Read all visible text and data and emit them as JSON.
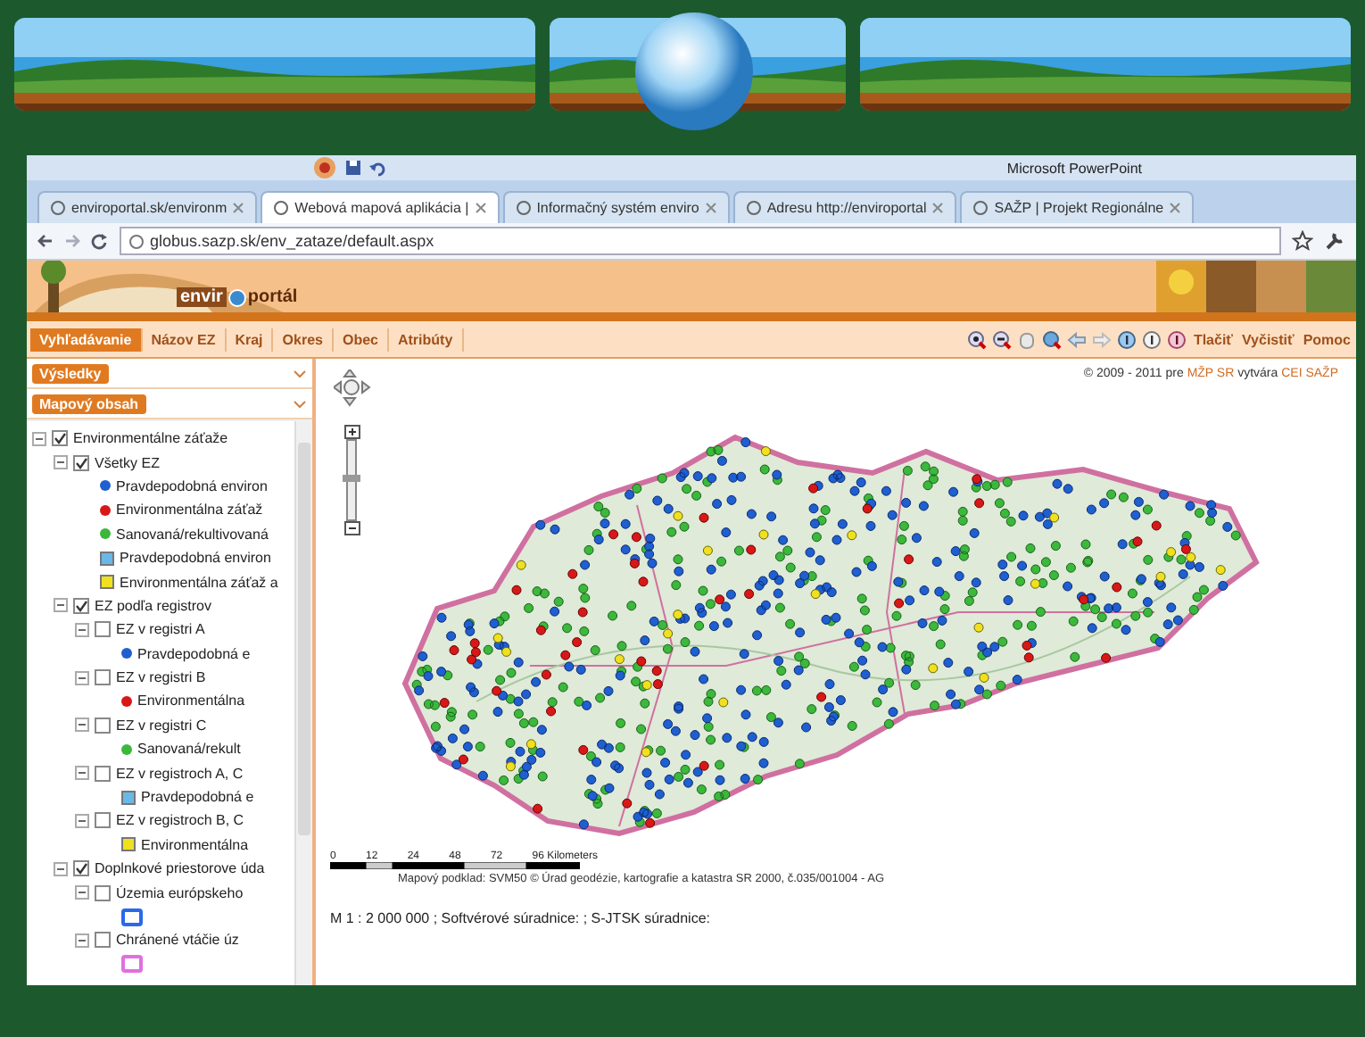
{
  "powerpoint": {
    "title": "Microsoft PowerPoint"
  },
  "browser": {
    "tabs": [
      {
        "label": "enviroportal.sk/environm",
        "selected": false
      },
      {
        "label": "Webová mapová aplikácia |",
        "selected": true
      },
      {
        "label": "Informačný systém enviro",
        "selected": false
      },
      {
        "label": "Adresu http://enviroportal",
        "selected": false
      },
      {
        "label": "SAŽP | Projekt Regionálne",
        "selected": false
      }
    ],
    "address": "globus.sazp.sk/env_zataze/default.aspx"
  },
  "portal": {
    "logo_left": "envir",
    "logo_right": "portál",
    "nav": [
      {
        "label": "Vyhľadávanie",
        "selected": true
      },
      {
        "label": "Názov EZ",
        "selected": false
      },
      {
        "label": "Kraj",
        "selected": false
      },
      {
        "label": "Okres",
        "selected": false
      },
      {
        "label": "Obec",
        "selected": false
      },
      {
        "label": "Atribúty",
        "selected": false
      }
    ],
    "actions": [
      "Tlačiť",
      "Vyčistiť",
      "Pomoc"
    ],
    "panels": [
      "Výsledky",
      "Mapový obsah"
    ],
    "tree": [
      {
        "label": "Environmentálne záťaže",
        "checked": true,
        "children": [
          {
            "label": "Všetky EZ",
            "checked": true,
            "legend": [
              {
                "label": "Pravdepodobná environ",
                "color": "#1f5fd0",
                "kind": "dot"
              },
              {
                "label": "Environmentálna záťaž",
                "color": "#d81818",
                "kind": "dot"
              },
              {
                "label": "Sanovaná/rekultivovaná",
                "color": "#3cb83c",
                "kind": "dot"
              },
              {
                "label": "Pravdepodobná environ",
                "color": "#6ab8e8",
                "kind": "square"
              },
              {
                "label": "Environmentálna záťaž a",
                "color": "#f0e020",
                "kind": "square"
              }
            ]
          },
          {
            "label": "EZ podľa registrov",
            "checked": true,
            "children": [
              {
                "label": "EZ v registri A",
                "checked": false,
                "legend": [
                  {
                    "label": "Pravdepodobná e",
                    "color": "#1f5fd0",
                    "kind": "dot"
                  }
                ]
              },
              {
                "label": "EZ v registri B",
                "checked": false,
                "legend": [
                  {
                    "label": "Environmentálna",
                    "color": "#d81818",
                    "kind": "dot"
                  }
                ]
              },
              {
                "label": "EZ v registri C",
                "checked": false,
                "legend": [
                  {
                    "label": "Sanovaná/rekult",
                    "color": "#3cb83c",
                    "kind": "dot"
                  }
                ]
              },
              {
                "label": "EZ v registroch A, C",
                "checked": false,
                "legend": [
                  {
                    "label": "Pravdepodobná e",
                    "color": "#6ab8e8",
                    "kind": "square"
                  }
                ]
              },
              {
                "label": "EZ v registroch B, C",
                "checked": false,
                "legend": [
                  {
                    "label": "Environmentálna",
                    "color": "#f0e020",
                    "kind": "square"
                  }
                ]
              }
            ]
          },
          {
            "label": "Doplnkové priestorove úda",
            "checked": true,
            "children": [
              {
                "label": "Územia európskeho",
                "checked": false,
                "legend": [
                  {
                    "color": "#2a6ae8",
                    "kind": "outline"
                  }
                ]
              },
              {
                "label": "Chránené vtáčie úz",
                "checked": false,
                "legend": [
                  {
                    "color": "#e070e0",
                    "kind": "outline"
                  }
                ]
              }
            ]
          }
        ]
      }
    ],
    "copyright": {
      "prefix": "© 2009 - 2011 pre",
      "link1": "MŽP SR",
      "middle": "vytvára",
      "link2": "CEI SAŽP"
    },
    "zoom_slider": {
      "level": 0.55
    },
    "scale_labels": [
      "0",
      "12",
      "24",
      "48",
      "72",
      "96 Kilometers"
    ],
    "map_credit": "Mapový podklad: SVM50 © Úrad geodézie, kartografie a katastra SR 2000, č.035/001004 - AG",
    "status": "M 1 : 2 000 000 ; Softvérové súradnice:  ; S-JTSK súradnice:"
  }
}
